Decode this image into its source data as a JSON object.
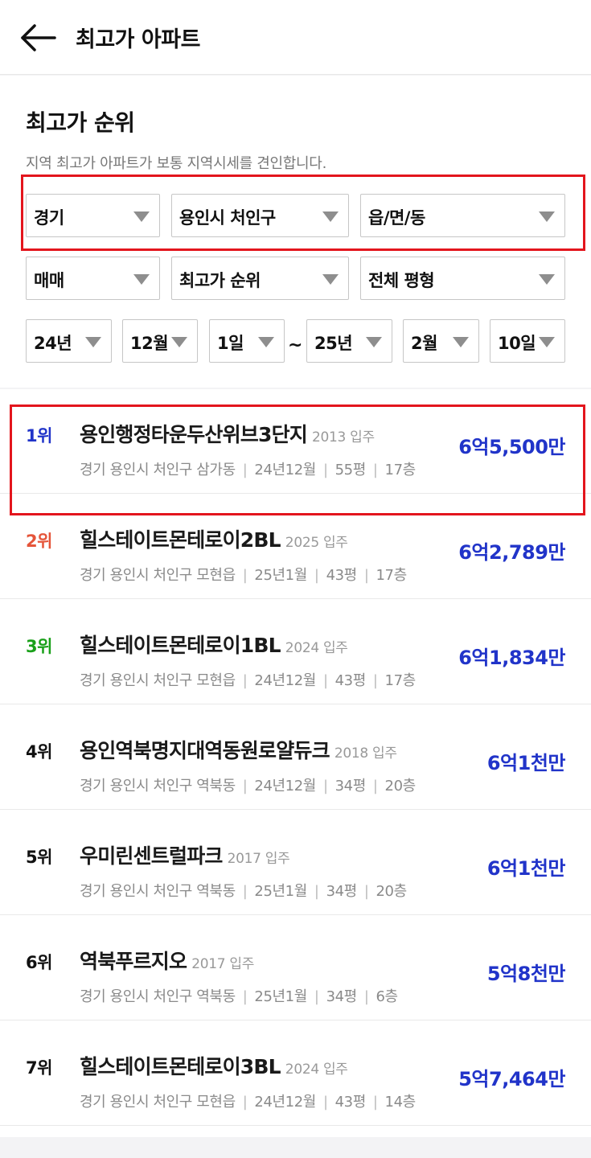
{
  "header": {
    "title": "최고가 아파트"
  },
  "section": {
    "title": "최고가 순위",
    "description": "지역 최고가 아파트가 보통 지역시세를 견인합니다."
  },
  "filters": {
    "region": "경기",
    "city": "용인시 처인구",
    "town": "읍/면/동",
    "deal_type": "매매",
    "sort": "최고가 순위",
    "size": "전체 평형",
    "from_year": "24년",
    "from_month": "12월",
    "from_day": "1일",
    "range_sep": "~",
    "to_year": "25년",
    "to_month": "2월",
    "to_day": "10일"
  },
  "colors": {
    "rank1": "#2134c9",
    "rank2": "#e5553a",
    "rank3": "#1aa01a",
    "rank_default": "#111111",
    "price": "#2134c9",
    "highlight": "#e3151d"
  },
  "ranking": [
    {
      "rank": "1위",
      "name": "용인행정타운두산위브3단지",
      "year": "2013 입주",
      "region": "경기 용인시 처인구 삼가동",
      "date": "24년12월",
      "size": "55평",
      "floor": "17층",
      "price": "6억5,500만"
    },
    {
      "rank": "2위",
      "name": "힐스테이트몬테로이2BL",
      "year": "2025 입주",
      "region": "경기 용인시 처인구 모현읍",
      "date": "25년1월",
      "size": "43평",
      "floor": "17층",
      "price": "6억2,789만"
    },
    {
      "rank": "3위",
      "name": "힐스테이트몬테로이1BL",
      "year": "2024 입주",
      "region": "경기 용인시 처인구 모현읍",
      "date": "24년12월",
      "size": "43평",
      "floor": "17층",
      "price": "6억1,834만"
    },
    {
      "rank": "4위",
      "name": "용인역북명지대역동원로얄듀크",
      "year": "2018 입주",
      "region": "경기 용인시 처인구 역북동",
      "date": "24년12월",
      "size": "34평",
      "floor": "20층",
      "price": "6억1천만"
    },
    {
      "rank": "5위",
      "name": "우미린센트럴파크",
      "year": "2017 입주",
      "region": "경기 용인시 처인구 역북동",
      "date": "25년1월",
      "size": "34평",
      "floor": "20층",
      "price": "6억1천만"
    },
    {
      "rank": "6위",
      "name": "역북푸르지오",
      "year": "2017 입주",
      "region": "경기 용인시 처인구 역북동",
      "date": "25년1월",
      "size": "34평",
      "floor": "6층",
      "price": "5억8천만"
    },
    {
      "rank": "7위",
      "name": "힐스테이트몬테로이3BL",
      "year": "2024 입주",
      "region": "경기 용인시 처인구 모현읍",
      "date": "24년12월",
      "size": "43평",
      "floor": "14층",
      "price": "5억7,464만"
    }
  ]
}
